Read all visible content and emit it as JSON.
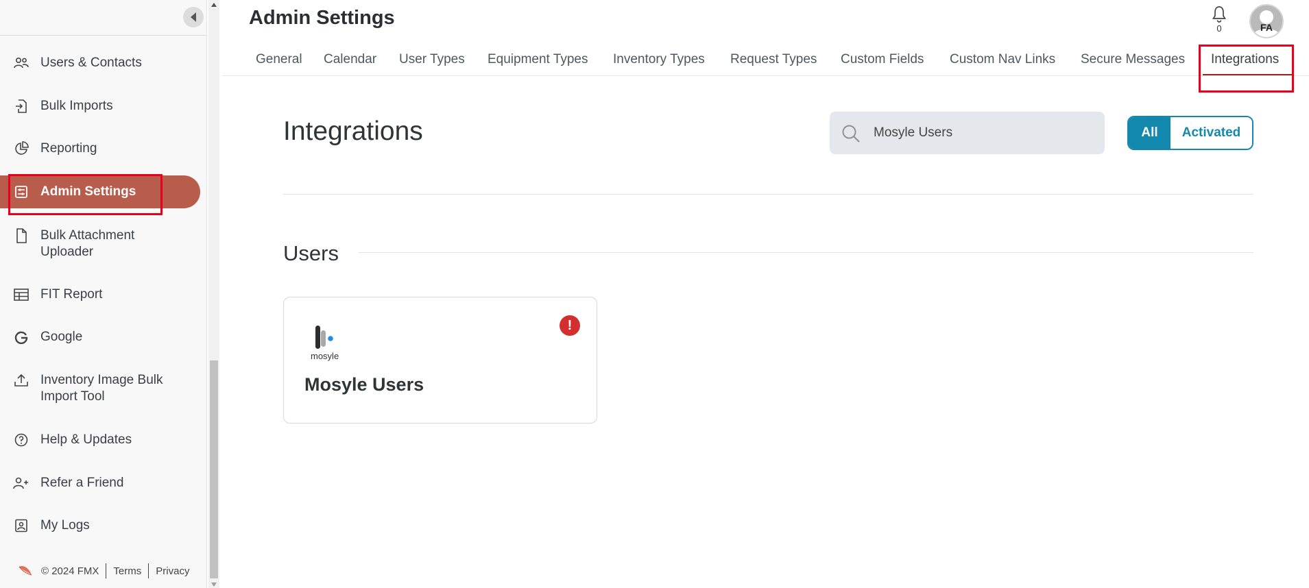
{
  "header": {
    "title": "Admin Settings",
    "notification_count": "0",
    "avatar_initials": "FA"
  },
  "sidebar": {
    "items": [
      {
        "label": "Users & Contacts",
        "icon": "users-icon"
      },
      {
        "label": "Bulk Imports",
        "icon": "import-icon"
      },
      {
        "label": "Reporting",
        "icon": "pie-chart-icon"
      },
      {
        "label": "Admin Settings",
        "icon": "settings-sliders-icon",
        "active": true
      },
      {
        "label": "Bulk Attachment Uploader",
        "icon": "file-icon"
      },
      {
        "label": "FIT Report",
        "icon": "table-icon"
      },
      {
        "label": "Google",
        "icon": "google-icon"
      },
      {
        "label": "Inventory Image Bulk Import Tool",
        "icon": "upload-icon"
      },
      {
        "label": "Help & Updates",
        "icon": "help-icon"
      },
      {
        "label": "Refer a Friend",
        "icon": "user-plus-icon"
      },
      {
        "label": "My Logs",
        "icon": "logs-icon"
      }
    ],
    "footer": {
      "copyright": "© 2024 FMX",
      "terms": "Terms",
      "privacy": "Privacy"
    }
  },
  "tabs": [
    {
      "label": "General"
    },
    {
      "label": "Calendar"
    },
    {
      "label": "User Types"
    },
    {
      "label": "Equipment Types"
    },
    {
      "label": "Inventory Types"
    },
    {
      "label": "Request Types"
    },
    {
      "label": "Custom Fields"
    },
    {
      "label": "Custom Nav Links"
    },
    {
      "label": "Secure Messages"
    },
    {
      "label": "Integrations",
      "active": true
    }
  ],
  "main": {
    "title": "Integrations",
    "search_value": "Mosyle Users",
    "filter": {
      "all": "All",
      "activated": "Activated",
      "selected": "All"
    },
    "groups": [
      {
        "title": "Users",
        "cards": [
          {
            "title": "Mosyle Users",
            "logo_text": "mosyle",
            "status": "!"
          }
        ]
      }
    ]
  },
  "colors": {
    "accent": "#1388ad",
    "active_nav": "#b85c4c",
    "alert": "#d32f2f",
    "highlight": "#e8001c"
  }
}
